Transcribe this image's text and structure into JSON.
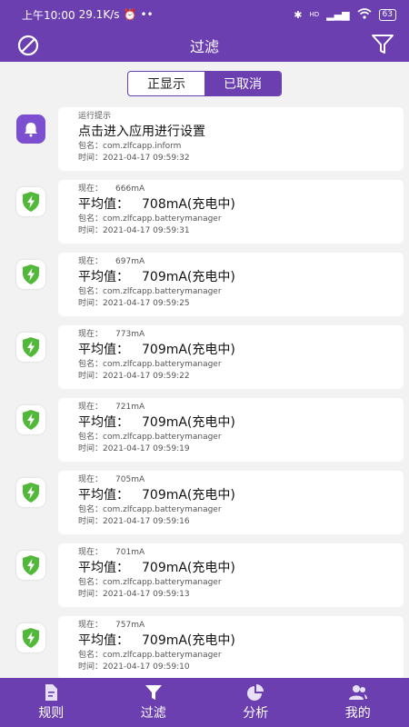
{
  "status": {
    "time": "上午10:00",
    "speed": "29.1K/s",
    "signal": "HD",
    "battery": "63"
  },
  "header": {
    "title": "过滤"
  },
  "segments": [
    {
      "label": "正显示",
      "active": false
    },
    {
      "label": "已取消",
      "active": true
    }
  ],
  "records": [
    {
      "icon": "bell-icon",
      "line1": "运行提示",
      "line2": "点击进入应用进行设置",
      "pkg_label": "包名：",
      "pkg": "com.zlfcapp.inform",
      "time_label": "时间：",
      "time": "2021-04-17 09:59:32"
    },
    {
      "icon": "shield-bolt-icon",
      "now_label": "现在：",
      "now": "666mA",
      "avg_label": "平均值：",
      "avg": "708mA(充电中)",
      "pkg_label": "包名：",
      "pkg": "com.zlfcapp.batterymanager",
      "time_label": "时间：",
      "time": "2021-04-17 09:59:31"
    },
    {
      "icon": "shield-bolt-icon",
      "now_label": "现在：",
      "now": "697mA",
      "avg_label": "平均值：",
      "avg": "709mA(充电中)",
      "pkg_label": "包名：",
      "pkg": "com.zlfcapp.batterymanager",
      "time_label": "时间：",
      "time": "2021-04-17 09:59:25"
    },
    {
      "icon": "shield-bolt-icon",
      "now_label": "现在：",
      "now": "773mA",
      "avg_label": "平均值：",
      "avg": "709mA(充电中)",
      "pkg_label": "包名：",
      "pkg": "com.zlfcapp.batterymanager",
      "time_label": "时间：",
      "time": "2021-04-17 09:59:22"
    },
    {
      "icon": "shield-bolt-icon",
      "now_label": "现在：",
      "now": "721mA",
      "avg_label": "平均值：",
      "avg": "709mA(充电中)",
      "pkg_label": "包名：",
      "pkg": "com.zlfcapp.batterymanager",
      "time_label": "时间：",
      "time": "2021-04-17 09:59:19"
    },
    {
      "icon": "shield-bolt-icon",
      "now_label": "现在：",
      "now": "705mA",
      "avg_label": "平均值：",
      "avg": "709mA(充电中)",
      "pkg_label": "包名：",
      "pkg": "com.zlfcapp.batterymanager",
      "time_label": "时间：",
      "time": "2021-04-17 09:59:16"
    },
    {
      "icon": "shield-bolt-icon",
      "now_label": "现在：",
      "now": "701mA",
      "avg_label": "平均值：",
      "avg": "709mA(充电中)",
      "pkg_label": "包名：",
      "pkg": "com.zlfcapp.batterymanager",
      "time_label": "时间：",
      "time": "2021-04-17 09:59:13"
    },
    {
      "icon": "shield-bolt-icon",
      "now_label": "现在：",
      "now": "757mA",
      "avg_label": "平均值：",
      "avg": "709mA(充电中)",
      "pkg_label": "包名：",
      "pkg": "com.zlfcapp.batterymanager",
      "time_label": "时间：",
      "time": "2021-04-17 09:59:10"
    }
  ],
  "tabs": [
    {
      "label": "规则",
      "icon": "document-icon",
      "active": false
    },
    {
      "label": "过滤",
      "icon": "funnel-icon",
      "active": true
    },
    {
      "label": "分析",
      "icon": "pie-chart-icon",
      "active": false
    },
    {
      "label": "我的",
      "icon": "users-icon",
      "active": false
    }
  ],
  "colors": {
    "primary": "#6b3fb0",
    "shield": "#52b83a",
    "background": "#f2f2f2"
  }
}
